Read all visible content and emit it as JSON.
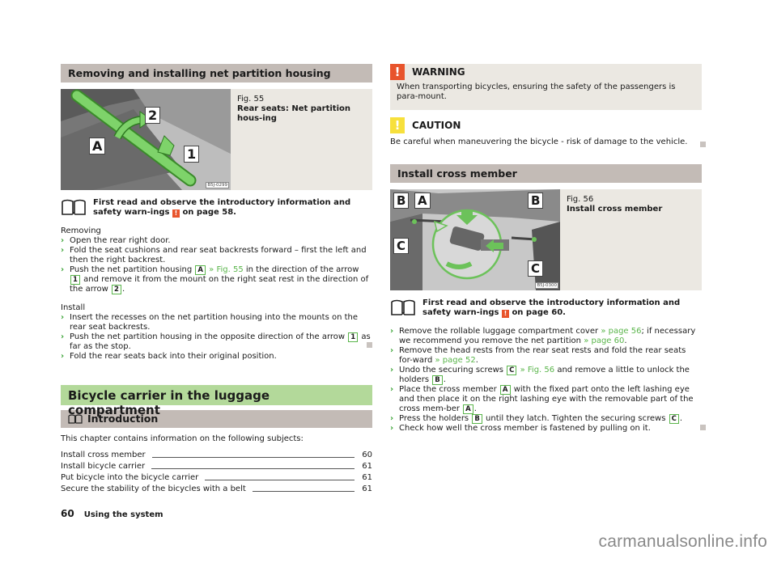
{
  "left": {
    "section_title": "Removing and installing net partition housing",
    "figure": {
      "number": "Fig. 55",
      "caption": "Rear seats: Net partition hous-ing",
      "code": "B5J-0299",
      "labels": {
        "a": "A",
        "one": "1",
        "two": "2"
      }
    },
    "read_note": {
      "text_before": "First read and observe the introductory information and safety warn-ings",
      "text_after": "on page 58.",
      "warn_glyph": "!"
    },
    "removing": {
      "heading": "Removing",
      "steps": [
        {
          "text": "Open the rear right door."
        },
        {
          "text": "Fold the seat cushions and rear seat backrests forward – first the left and then the right backrest."
        },
        {
          "p1": "Push the net partition housing",
          "key1": "A",
          "ref": "» Fig. 55",
          "p2": "in the direction of the arrow",
          "key2": "1",
          "p3": "and remove it from the mount on the right seat rest in the direction of the arrow",
          "key3": "2",
          "p4": "."
        }
      ]
    },
    "install": {
      "heading": "Install",
      "steps": [
        {
          "text": "Insert the recesses on the net partition housing into the mounts on the rear seat backrests."
        },
        {
          "p1": "Push the net partition housing in the opposite direction of the arrow",
          "key1": "1",
          "p2": "as far as the stop."
        },
        {
          "text": "Fold the rear seats back into their original position."
        }
      ]
    },
    "chapter_title": "Bicycle carrier in the luggage compartment",
    "intro": {
      "title": "Introduction",
      "lead": "This chapter contains information on the following subjects:",
      "toc": [
        {
          "label": "Install cross member",
          "page": "60"
        },
        {
          "label": "Install bicycle carrier",
          "page": "61"
        },
        {
          "label": "Put bicycle into the bicycle carrier",
          "page": "61"
        },
        {
          "label": "Secure the stability of the bicycles with a belt",
          "page": "61"
        }
      ]
    }
  },
  "right": {
    "warning": {
      "title": "WARNING",
      "glyph": "!",
      "text": "When transporting bicycles, ensuring the safety of the passengers is para-mount.",
      "color": "#e8542c"
    },
    "caution": {
      "title": "CAUTION",
      "glyph": "!",
      "text": "Be careful when maneuvering the bicycle - risk of damage to the vehicle.",
      "color": "#f7e03c"
    },
    "section_title": "Install cross member",
    "figure": {
      "number": "Fig. 56",
      "caption": "Install cross member",
      "code": "B5J-0300",
      "labels": {
        "a": "A",
        "b": "B",
        "c": "C"
      }
    },
    "read_note": {
      "text_before": "First read and observe the introductory information and safety warn-ings",
      "text_after": "on page 60.",
      "warn_glyph": "!"
    },
    "steps": [
      {
        "p1": "Remove the rollable luggage compartment cover",
        "ref1": "» page 56",
        "p2": "; if necessary we recommend you remove the net partition",
        "ref2": "» page 60",
        "p3": "."
      },
      {
        "p1": "Remove the head rests from the rear seat rests and fold the rear seats for-ward",
        "ref1": "» page 52",
        "p2": "."
      },
      {
        "p1": "Undo the securing screws",
        "key1": "C",
        "ref1": "» Fig. 56",
        "p2": "and remove a little to unlock the holders",
        "key2": "B",
        "p3": "."
      },
      {
        "p1": "Place the cross member",
        "key1": "A",
        "p2": "with the fixed part onto the left lashing eye and then place it on the right lashing eye with the removable part of the cross mem-ber",
        "key2": "A",
        "p3": "."
      },
      {
        "p1": "Press the holders",
        "key1": "B",
        "p2": "until they latch. Tighten the securing screws",
        "key2": "C",
        "p3": "."
      },
      {
        "text": "Check how well the cross member is fastened by pulling on it."
      }
    ]
  },
  "footer": {
    "page_number": "60",
    "section": "Using the system"
  },
  "watermark": "carmanualsonline.info",
  "colors": {
    "accent_green": "#5ab54b",
    "section_bg": "#c3bbb6",
    "chapter_bg": "#b3d99a",
    "figure_bg": "#ebe8e2"
  }
}
